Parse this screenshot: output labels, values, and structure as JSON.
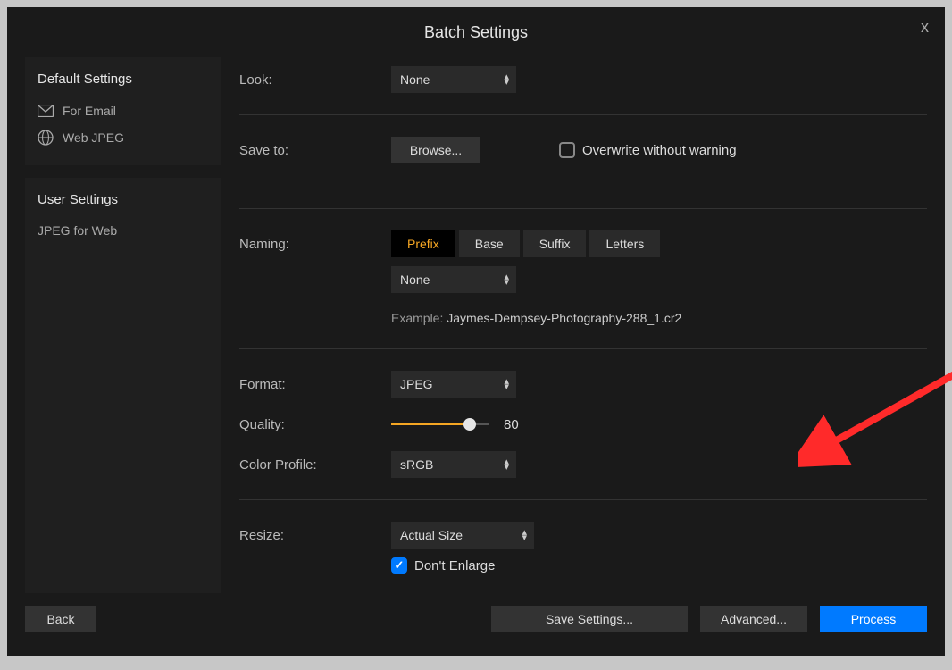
{
  "title": "Batch Settings",
  "close": "x",
  "sidebar": {
    "default_title": "Default Settings",
    "items": [
      {
        "label": "For Email"
      },
      {
        "label": "Web JPEG"
      }
    ],
    "user_title": "User Settings",
    "user_items": [
      {
        "label": "JPEG for Web"
      }
    ],
    "back": "Back"
  },
  "labels": {
    "look": "Look:",
    "save_to": "Save to:",
    "naming": "Naming:",
    "format": "Format:",
    "quality": "Quality:",
    "color_profile": "Color Profile:",
    "resize": "Resize:"
  },
  "look": {
    "value": "None"
  },
  "save": {
    "browse": "Browse...",
    "overwrite": "Overwrite without warning"
  },
  "naming": {
    "tabs": [
      "Prefix",
      "Base",
      "Suffix",
      "Letters"
    ],
    "active": 0,
    "value": "None",
    "example_label": "Example: ",
    "example_file": "Jaymes-Dempsey-Photography-288_1.cr2"
  },
  "format": {
    "value": "JPEG"
  },
  "quality": {
    "value": "80",
    "percent": 80
  },
  "color_profile": {
    "value": "sRGB"
  },
  "resize": {
    "value": "Actual Size",
    "dont_enlarge": "Don't Enlarge"
  },
  "footer": {
    "save_settings": "Save Settings...",
    "advanced": "Advanced...",
    "process": "Process"
  }
}
